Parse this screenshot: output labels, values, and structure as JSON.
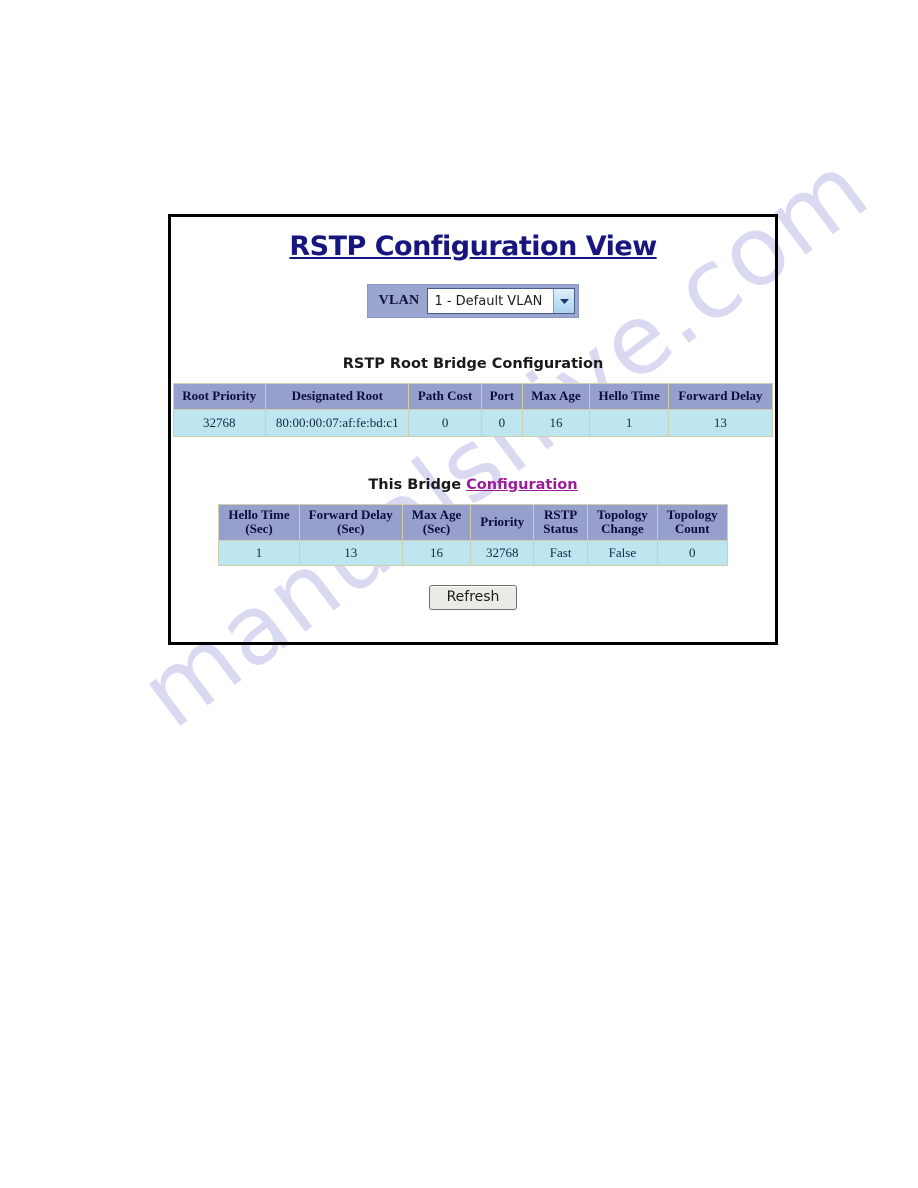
{
  "page": {
    "title": "RSTP Configuration View",
    "watermark": "manualshive.com"
  },
  "vlan_selector": {
    "label": "VLAN",
    "selected": "1 - Default VLAN",
    "options": [
      "1 - Default VLAN"
    ],
    "arrow_icon": "chevron-down-icon"
  },
  "root_bridge": {
    "heading": "RSTP Root Bridge Configuration",
    "columns": [
      "Root Priority",
      "Designated Root",
      "Path Cost",
      "Port",
      "Max Age",
      "Hello Time",
      "Forward Delay"
    ],
    "row": [
      "32768",
      "80:00:00:07:af:fe:bd:c1",
      "0",
      "0",
      "16",
      "1",
      "13"
    ]
  },
  "this_bridge": {
    "heading_prefix": "This Bridge ",
    "heading_link": "Configuration",
    "columns": [
      {
        "line1": "Hello Time",
        "line2": "(Sec)"
      },
      {
        "line1": "Forward Delay",
        "line2": "(Sec)"
      },
      {
        "line1": "Max Age",
        "line2": "(Sec)"
      },
      {
        "line1": "Priority",
        "line2": ""
      },
      {
        "line1": "RSTP",
        "line2": "Status"
      },
      {
        "line1": "Topology",
        "line2": "Change"
      },
      {
        "line1": "Topology",
        "line2": "Count"
      }
    ],
    "row": [
      "1",
      "13",
      "16",
      "32768",
      "Fast",
      "False",
      "0"
    ]
  },
  "actions": {
    "refresh_label": "Refresh"
  },
  "colors": {
    "title": "#16167e",
    "table_header_bg": "#97a0cc",
    "table_cell_bg": "#bde6f0",
    "table_border": "#cfcfb0",
    "link": "#9b1c9b",
    "vlan_bar": "#9aa6cf"
  }
}
